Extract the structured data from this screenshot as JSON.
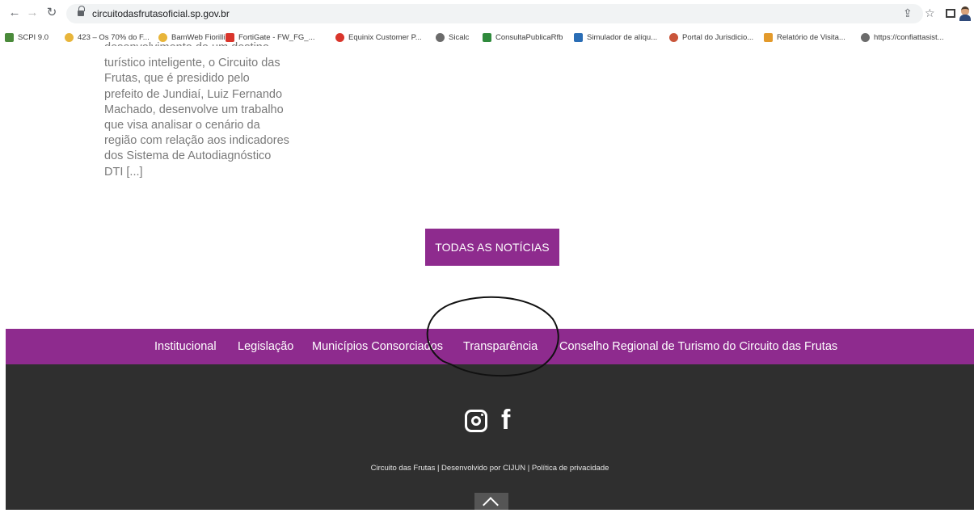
{
  "browser": {
    "url": "circuitodasfrutasoficial.sp.gov.br",
    "bookmarks": [
      {
        "label": "SCPI 9.0",
        "color": "#4a8a3a"
      },
      {
        "label": "423 – Os 70% do F...",
        "color": "#e8b53a"
      },
      {
        "label": "BamWeb Fiorilli",
        "color": "#e8b53a"
      },
      {
        "label": "FortiGate - FW_FG_...",
        "color": "#d9352b"
      },
      {
        "label": "Equinix Customer P...",
        "color": "#d9352b"
      },
      {
        "label": "Sicalc",
        "color": "#6b6b6b"
      },
      {
        "label": "ConsultaPublicaRfb",
        "color": "#2f8a3c"
      },
      {
        "label": "Simulador de alíqu...",
        "color": "#2a6db5"
      },
      {
        "label": "Portal do Jurisdicio...",
        "color": "#c9553a"
      },
      {
        "label": "Relatório de Visita...",
        "color": "#e39a2b"
      },
      {
        "label": "https://confiattasist...",
        "color": "#6b6b6b"
      }
    ]
  },
  "article": {
    "excerpt": "desenvolvimento de um destino turístico inteligente, o Circuito das Frutas, que é presidido pelo prefeito de Jundiaí, Luiz Fernando Machado, desenvolve um trabalho que visa analisar o cenário da região com relação aos indicadores dos Sistema de Autodiagnóstico DTI [...]",
    "all_news_button": "TODAS AS NOTÍCIAS"
  },
  "footer_nav": {
    "items": [
      "Institucional",
      "Legislação",
      "Municípios Consorciados",
      "Transparência",
      "Conselho Regional de Turismo do Circuito das Frutas"
    ]
  },
  "footer": {
    "social": [
      "instagram-icon",
      "facebook-icon"
    ],
    "facebook_glyph": "f",
    "credits": "Circuito das Frutas | Desenvolvido por CIJUN | Política de privacidade"
  },
  "colors": {
    "brand_purple": "#8e2b8e",
    "footer_dark": "#2f2f2f"
  }
}
